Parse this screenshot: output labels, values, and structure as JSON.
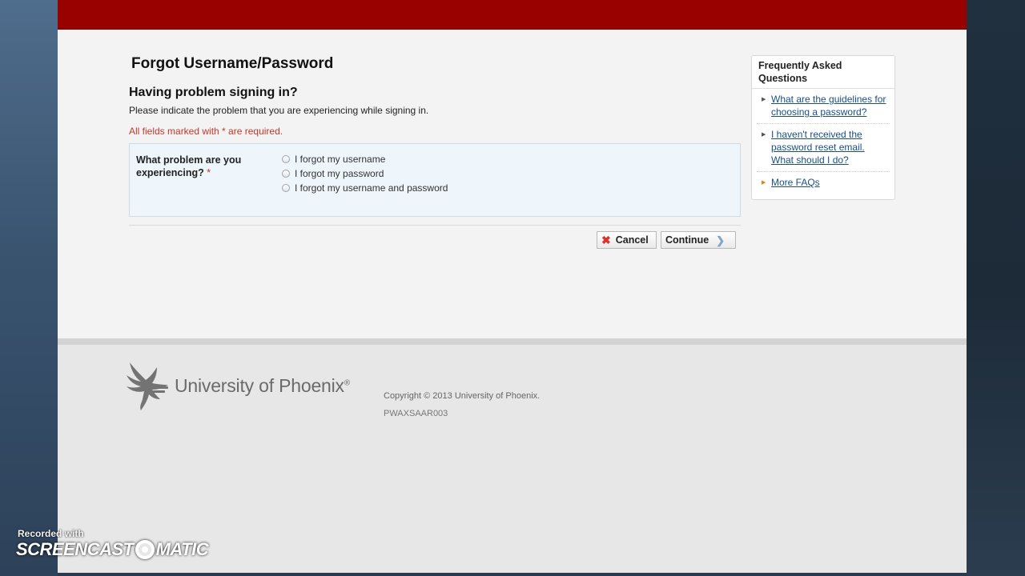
{
  "page": {
    "title": "Forgot Username/Password",
    "section_title": "Having problem signing in?",
    "instructions": "Please indicate the problem that you are experiencing while signing in.",
    "required_note": "All fields marked with * are required."
  },
  "form": {
    "question": "What problem are you experiencing?",
    "required_marker": "*",
    "options": [
      {
        "label": "I forgot my username",
        "selected": false
      },
      {
        "label": "I forgot my password",
        "selected": false
      },
      {
        "label": "I forgot my username and password",
        "selected": false
      }
    ]
  },
  "buttons": {
    "cancel": "Cancel",
    "continue": "Continue"
  },
  "faq": {
    "title": "Frequently Asked Questions",
    "items": [
      "What are the guidelines for choosing a password?",
      "I haven't received the password reset email. What should I do?",
      "More FAQs"
    ]
  },
  "footer": {
    "logo_text": "University of Phoenix",
    "logo_mark": "®",
    "copyright": "Copyright © 2013 University of Phoenix.",
    "page_code": "PWAXSAAR003"
  },
  "watermark": {
    "line1": "Recorded with",
    "brand_left": "SCREENCAST",
    "brand_right": "MATIC"
  },
  "colors": {
    "header": "#990000",
    "link": "#1a4f85",
    "required": "#c0392b",
    "faq_bullet_accent": "#e67e22"
  },
  "icons": {
    "cancel": "x-icon",
    "continue": "chevron-right-icon",
    "logo": "phoenix-bird-icon"
  }
}
